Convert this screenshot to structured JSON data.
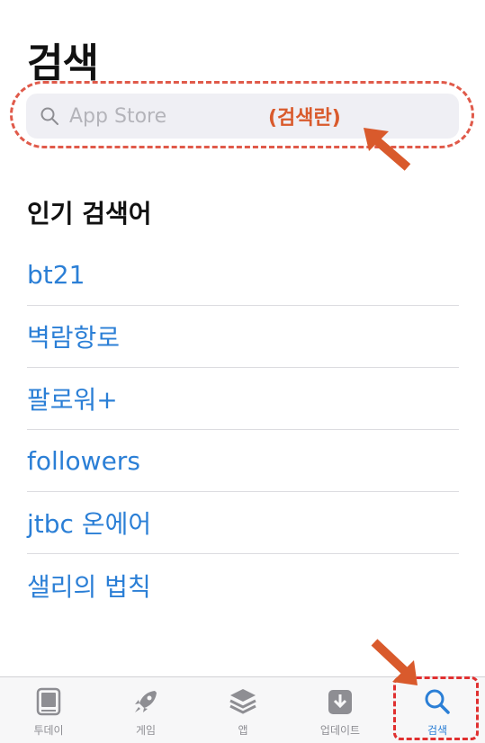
{
  "header": {
    "title": "검색"
  },
  "search": {
    "placeholder": "App Store",
    "annotation": "(검색란)"
  },
  "trending": {
    "heading": "인기 검색어",
    "items": [
      "bt21",
      "벽람항로",
      "팔로워+",
      "followers",
      "jtbc 온에어",
      "샐리의 법칙"
    ]
  },
  "tabbar": {
    "tabs": [
      {
        "label": "투데이",
        "icon": "today-icon"
      },
      {
        "label": "게임",
        "icon": "rocket-icon"
      },
      {
        "label": "앱",
        "icon": "apps-stack-icon"
      },
      {
        "label": "업데이트",
        "icon": "download-tray-icon"
      },
      {
        "label": "검색",
        "icon": "search-icon"
      }
    ],
    "active": "검색"
  },
  "colors": {
    "accent": "#2b7fd6",
    "annotation": "#e05a4a",
    "inactive": "#8e8e93"
  }
}
